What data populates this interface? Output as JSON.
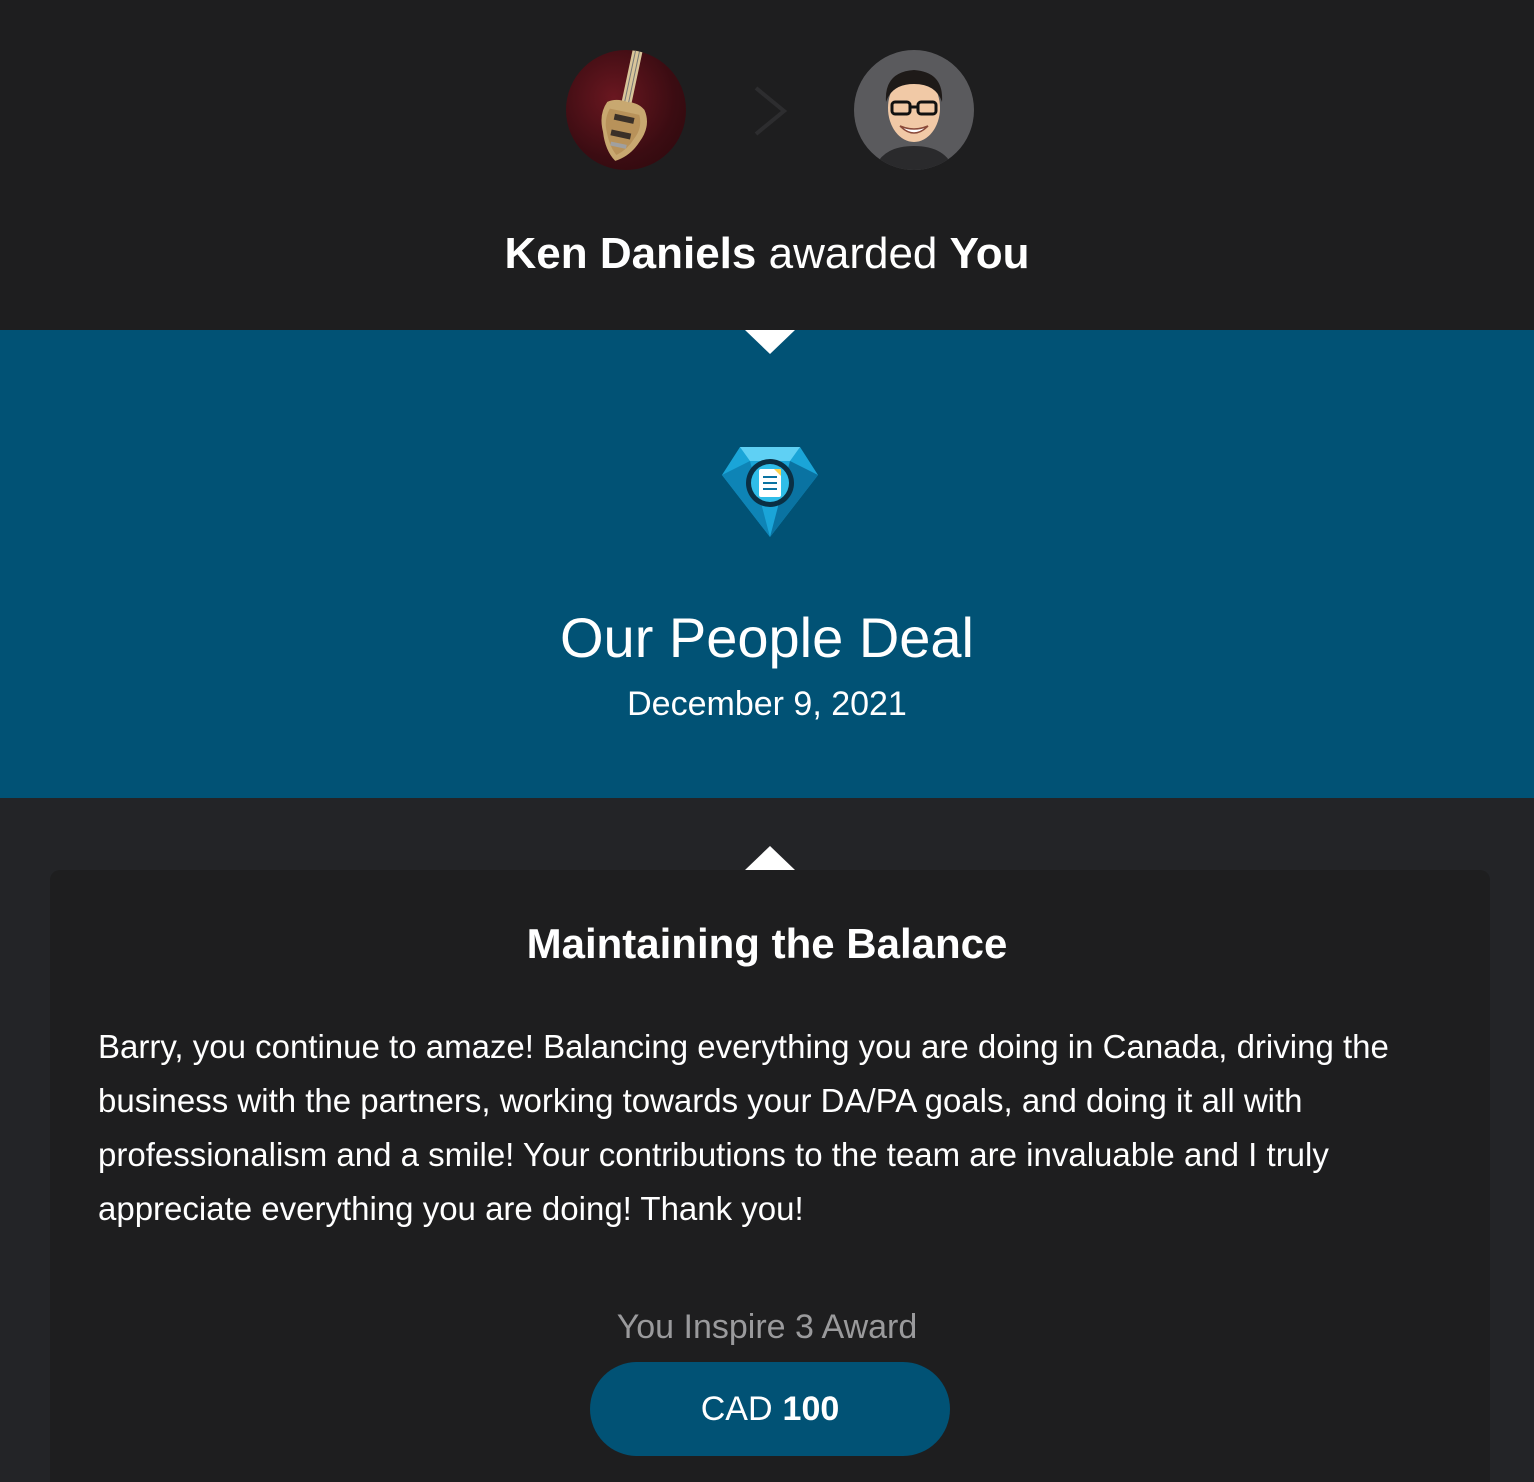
{
  "header": {
    "giver_name": "Ken Daniels",
    "action_text": "awarded",
    "receiver_name": "You"
  },
  "award": {
    "program_name": "Our People Deal",
    "date": "December 9, 2021",
    "icon": "diamond-document-icon"
  },
  "message": {
    "title": "Maintaining the Balance",
    "body": "Barry, you continue to amaze! Balancing everything you are doing in Canada, driving the business with the partners, working towards your DA/PA goals, and doing it all with professionalism and a smile! Your contributions to the team are invaluable and I truly appreciate everything you are doing! Thank you!"
  },
  "points": {
    "award_name": "You Inspire 3 Award",
    "currency": "CAD",
    "value": "100"
  },
  "colors": {
    "header_bg": "#1e1e1f",
    "band_bg": "#015275",
    "page_bg": "#232427",
    "pill_bg": "#015275",
    "muted_text": "#9a9a9c"
  }
}
